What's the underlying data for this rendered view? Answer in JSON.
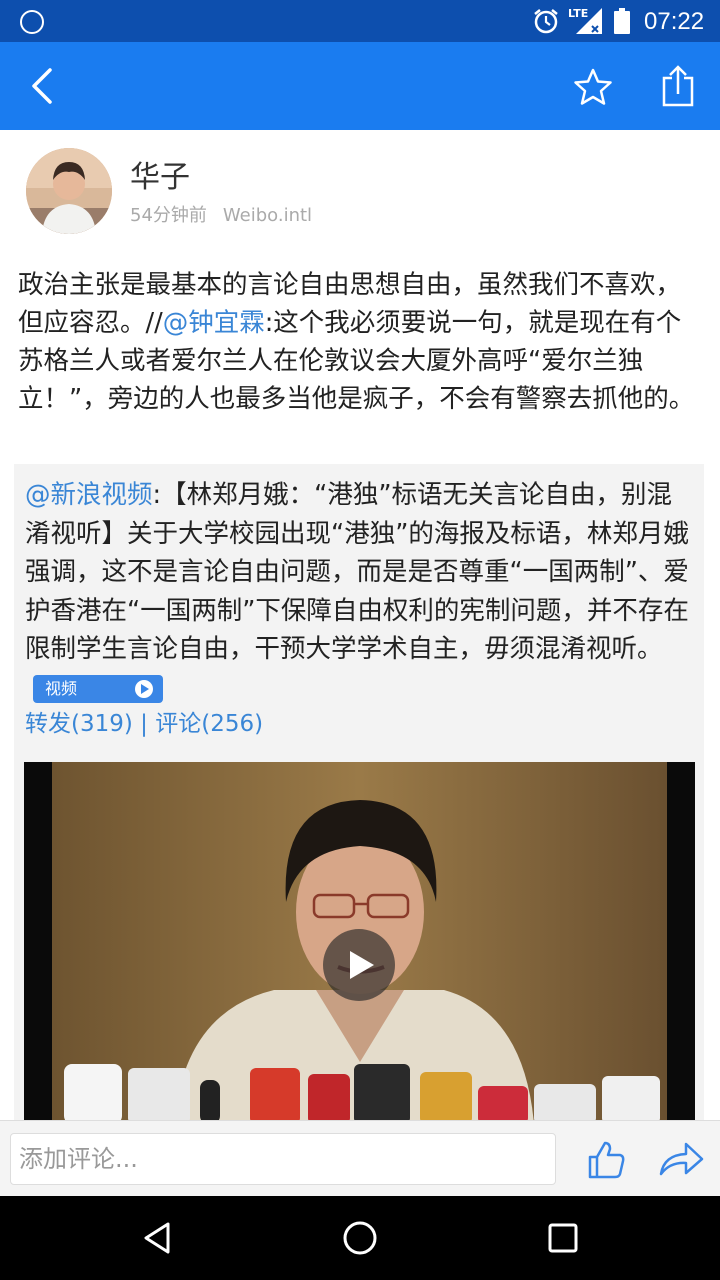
{
  "status_bar": {
    "time": "07:22",
    "network": "LTE"
  },
  "post": {
    "user_name": "华子",
    "time_ago": "54分钟前",
    "source": "Weibo.intl",
    "text_before": "政治主张是最基本的言论自由思想自由，虽然我们不喜欢，但应容忍。//",
    "mention": "@钟宜霖",
    "text_after": ":这个我必须要说一句，就是现在有个苏格兰人或者爱尔兰人在伦敦议会大厦外高呼“爱尔兰独立！”，旁边的人也最多当他是疯子，不会有警察去抓他的。"
  },
  "quoted": {
    "mention": "@新浪视频",
    "text": ":【林郑月娥：“港独”标语无关言论自由，别混淆视听】关于大学校园出现“港独”的海报及标语，林郑月娥强调，这不是言论自由问题，而是是否尊重“一国两制”、爱护香港在“一国两制”下保障自由权利的宪制问题，并不存在限制学生言论自由，干预大学学术自主，毋须混淆视听。",
    "video_tag": "视频",
    "reposts": "转发(319)",
    "separator": " | ",
    "comments": "评论(256)"
  },
  "comment_bar": {
    "placeholder": "添加评论..."
  },
  "colors": {
    "status_bar": "#0d4fae",
    "app_bar": "#1a7cf0",
    "link": "#3a86d6"
  },
  "icons": [
    "back-icon",
    "star-icon",
    "share-icon",
    "like-icon",
    "forward-icon",
    "nav-back-icon",
    "nav-home-icon",
    "nav-recents-icon"
  ]
}
